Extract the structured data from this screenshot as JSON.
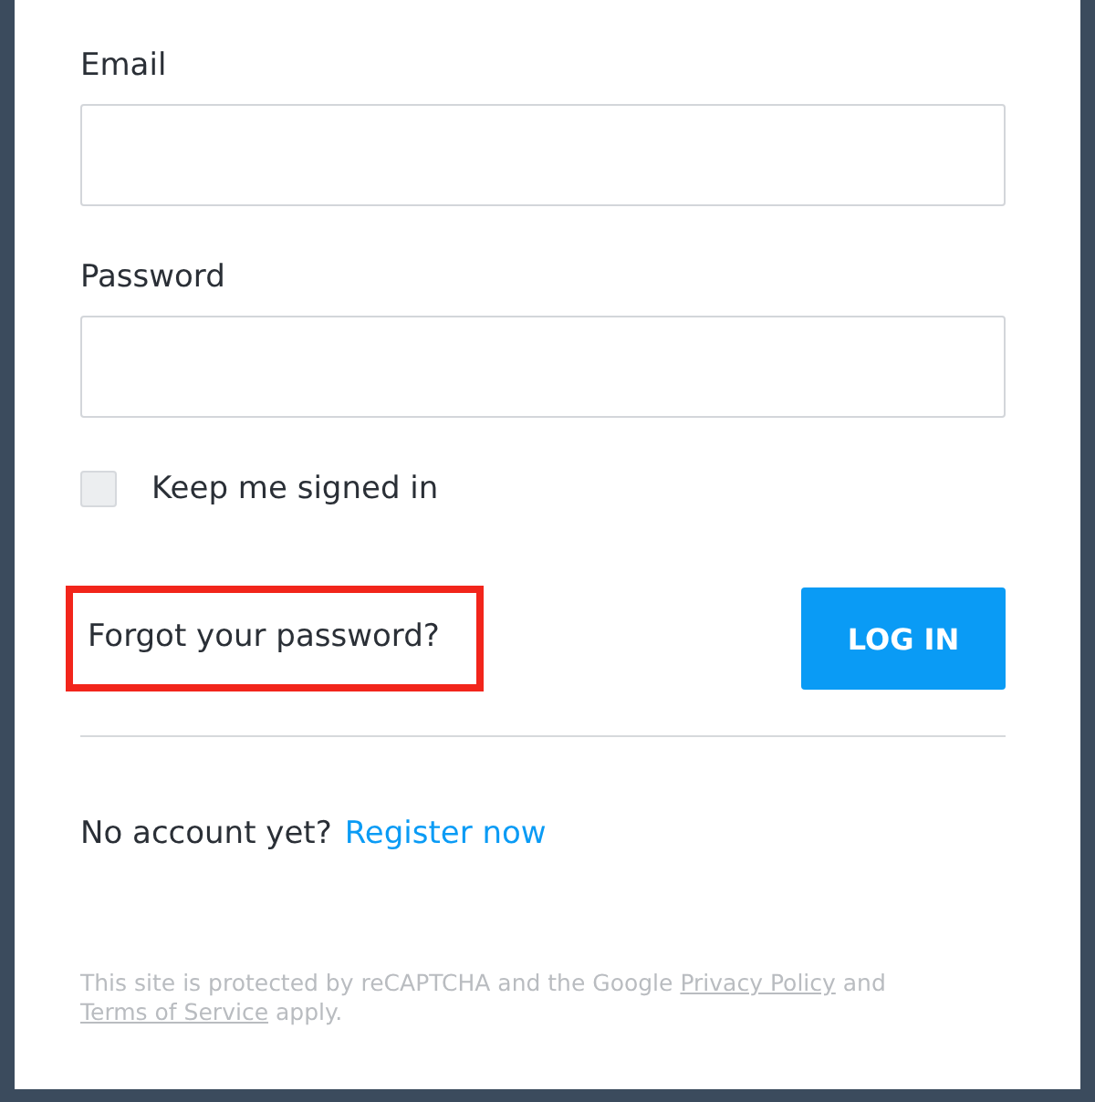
{
  "email": {
    "label": "Email"
  },
  "password": {
    "label": "Password"
  },
  "keep_signed_in": {
    "label": "Keep me signed in",
    "checked": false
  },
  "forgot_link": {
    "label": "Forgot your password?",
    "highlighted": true
  },
  "login_button": {
    "label": "LOG IN"
  },
  "register": {
    "prompt": "No account yet?",
    "link": "Register now"
  },
  "recaptcha": {
    "before": "This site is protected by reCAPTCHA and the Google",
    "privacy": "Privacy Policy",
    "and": "and",
    "terms": "Terms of Service",
    "after": "apply."
  }
}
